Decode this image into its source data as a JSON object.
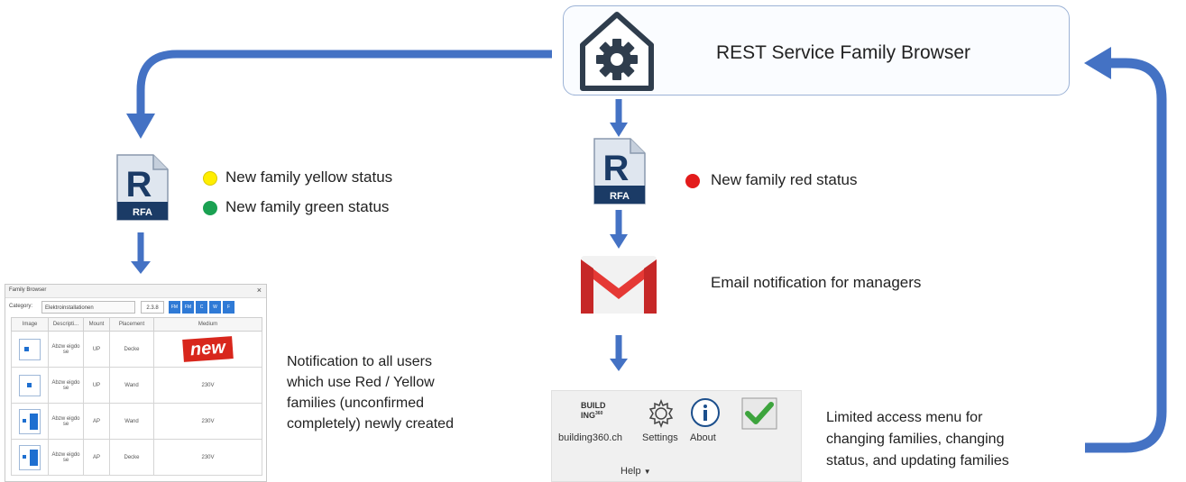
{
  "service": {
    "title": "REST Service Family Browser"
  },
  "left_status": [
    {
      "label": "New family yellow status",
      "color": "#ffee00"
    },
    {
      "label": "New family green status",
      "color": "#1aa152"
    }
  ],
  "right_status": {
    "label": "New family red status",
    "color": "#e31b1b"
  },
  "rfa_label": "RFA",
  "email_text": "Email notification for managers",
  "notification_text": [
    "Notification to all users",
    "which use Red / Yellow",
    "families (unconfirmed",
    "completely) newly created"
  ],
  "limited_text": [
    "Limited access menu for",
    "changing families, changing",
    "status, and updating families"
  ],
  "family_browser": {
    "title": "Family Browser",
    "category_label": "Category:",
    "category_value": "Elektroinstallationen",
    "version": "2.3.8",
    "toolbar_buttons": [
      "FM",
      "FM",
      "C",
      "W",
      "F"
    ],
    "columns": [
      "Image",
      "Descripti...",
      "Mount",
      "Placement",
      "Medium"
    ],
    "rows": [
      {
        "desc": "Abzw eigdo se",
        "mount": "UP",
        "placement": "Decke",
        "medium": "new"
      },
      {
        "desc": "Abzw eigdo se",
        "mount": "UP",
        "placement": "Wand",
        "medium": "230V"
      },
      {
        "desc": "Abzw eigdo se",
        "mount": "AP",
        "placement": "Wand",
        "medium": "230V"
      },
      {
        "desc": "Abzw eigdo se",
        "mount": "AP",
        "placement": "Decke",
        "medium": "230V"
      }
    ]
  },
  "ribbon": {
    "logo_line1": "BUILD",
    "logo_line2": "ING",
    "logo_sup": "360",
    "items": [
      "building360.ch",
      "Settings",
      "About"
    ],
    "group": "Help"
  },
  "colors": {
    "arrow": "#4472c4",
    "rfa_dark": "#1b3b66",
    "gear": "#2f3d4d"
  }
}
